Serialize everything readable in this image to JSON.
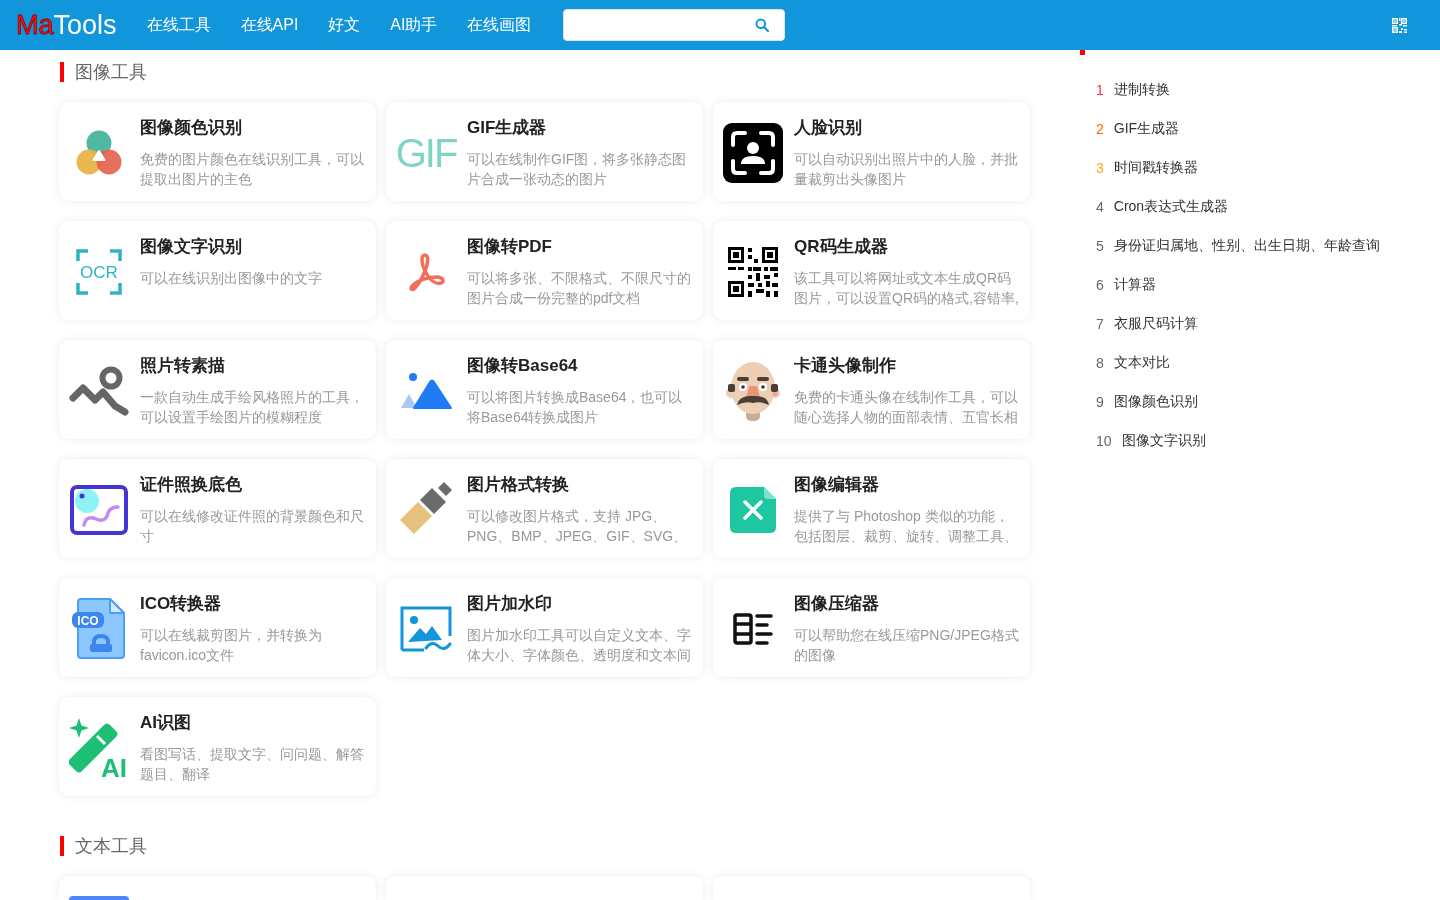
{
  "header": {
    "logo": {
      "accent": "Ma",
      "text": "Tools"
    },
    "nav": [
      "在线工具",
      "在线API",
      "好文",
      "AI助手",
      "在线画图"
    ]
  },
  "sections": [
    {
      "title": "图像工具",
      "cards": [
        {
          "kind": "tool",
          "title": "图像颜色识别",
          "desc": "免费的图片颜色在线识别工具，可以提取出图片的主色"
        },
        {
          "kind": "tool",
          "title": "GIF生成器",
          "icon_text": "GIF",
          "desc": "可以在线制作GIF图，将多张静态图片合成一张动态的图片"
        },
        {
          "kind": "tool",
          "title": "人脸识别",
          "desc": "可以自动识别出照片中的人脸，并批量裁剪出头像图片"
        },
        {
          "kind": "tool",
          "title": "图像文字识别",
          "icon_text": "OCR",
          "desc": "可以在线识别出图像中的文字"
        },
        {
          "kind": "tool",
          "title": "图像转PDF",
          "desc": "可以将多张、不限格式、不限尺寸的图片合成一份完整的pdf文档"
        },
        {
          "kind": "tool",
          "title": "QR码生成器",
          "desc": "该工具可以将网址或文本生成QR码图片，可以设置QR码的格式,容错率,"
        },
        {
          "kind": "tool",
          "title": "照片转素描",
          "desc": "一款自动生成手绘风格照片的工具，可以设置手绘图片的模糊程度"
        },
        {
          "kind": "tool",
          "title": "图像转Base64",
          "desc": "可以将图片转换成Base64，也可以将Base64转换成图片"
        },
        {
          "kind": "tool",
          "title": "卡通头像制作",
          "desc": "免费的卡通头像在线制作工具，可以随心选择人物的面部表情、五官长相"
        },
        {
          "kind": "tool",
          "title": "证件照换底色",
          "desc": "可以在线修改证件照的背景颜色和尺寸"
        },
        {
          "kind": "tool",
          "title": "图片格式转换",
          "desc": "可以修改图片格式，支持 JPG、PNG、BMP、JPEG、GIF、SVG、"
        },
        {
          "kind": "tool",
          "title": "图像编辑器",
          "desc": "提供了与 Photoshop 类似的功能，包括图层、裁剪、旋转、调整工具、"
        },
        {
          "kind": "tool",
          "title": "ICO转换器",
          "icon_text": "ICO",
          "desc": "可以在线裁剪图片，并转换为favicon.ico文件"
        },
        {
          "kind": "tool",
          "title": "图片加水印",
          "desc": "图片加水印工具可以自定义文本、字体大小、字体颜色、透明度和文本间"
        },
        {
          "kind": "tool",
          "title": "图像压缩器",
          "desc": "可以帮助您在线压缩PNG/JPEG格式的图像"
        },
        {
          "kind": "tool",
          "title": "AI识图",
          "icon_text": "AI",
          "desc": "看图写话、提取文字、问问题、解答题目、翻译"
        }
      ]
    },
    {
      "title": "文本工具",
      "cards": [
        {
          "kind": "cut"
        },
        {
          "kind": "cut"
        },
        {
          "kind": "cut"
        }
      ]
    }
  ],
  "sidebar": {
    "items": [
      {
        "rank": "1",
        "label": "进制转换",
        "color": "#fe2d46"
      },
      {
        "rank": "2",
        "label": "GIF生成器",
        "color": "#ff6600"
      },
      {
        "rank": "3",
        "label": "时间戳转换器",
        "color": "#faa90e"
      },
      {
        "rank": "4",
        "label": "Cron表达式生成器",
        "color": "#666666"
      },
      {
        "rank": "5",
        "label": "身份证归属地、性别、出生日期、年龄查询",
        "color": "#666666"
      },
      {
        "rank": "6",
        "label": "计算器",
        "color": "#666666"
      },
      {
        "rank": "7",
        "label": "衣服尺码计算",
        "color": "#666666"
      },
      {
        "rank": "8",
        "label": "文本对比",
        "color": "#666666"
      },
      {
        "rank": "9",
        "label": "图像颜色识别",
        "color": "#666666"
      },
      {
        "rank": "10",
        "label": "图像文字识别",
        "color": "#666666"
      }
    ]
  }
}
